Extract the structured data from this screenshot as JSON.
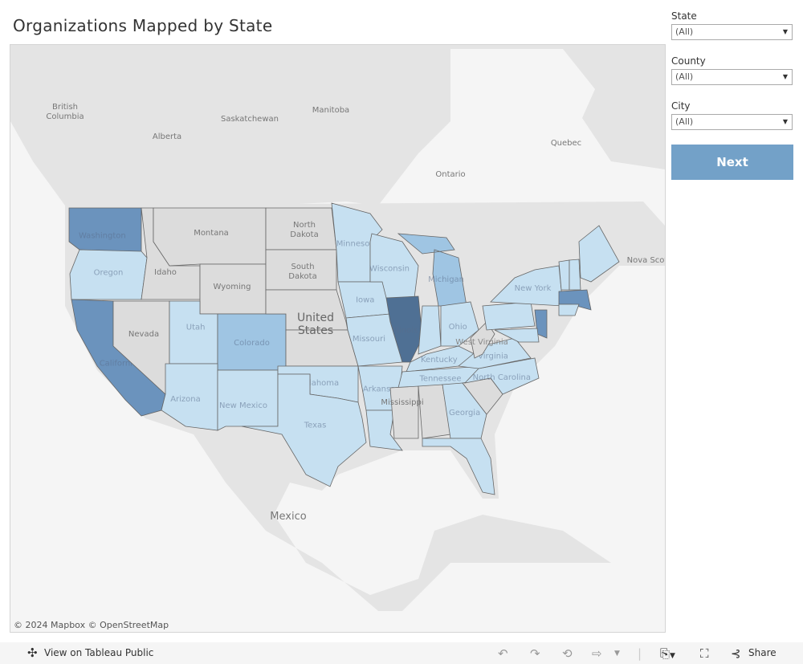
{
  "title": "Organizations Mapped by State",
  "filters": [
    {
      "label": "State",
      "value": "(All)"
    },
    {
      "label": "County",
      "value": "(All)"
    },
    {
      "label": "City",
      "value": "(All)"
    }
  ],
  "next_button": "Next",
  "map": {
    "attribution": "© 2024 Mapbox  © OpenStreetMap",
    "colors": {
      "none": "#dcdcdc",
      "light": "#c6e0f1",
      "medium": "#9fc5e3",
      "dark": "#6b93bd",
      "darkest": "#4f7094",
      "land": "#e4e4e4",
      "water": "#f5f5f5"
    },
    "base_labels": [
      "British Columbia",
      "Alberta",
      "Saskatchewan",
      "Manitoba",
      "Ontario",
      "Quebec",
      "Nova Scot",
      "Montana",
      "Idaho",
      "Wyoming",
      "North Dakota",
      "South Dakota",
      "Nevada",
      "United States",
      "Mexico",
      "Mississippi"
    ],
    "states": [
      {
        "name": "Washington",
        "level": "dark",
        "label": "Washington"
      },
      {
        "name": "Oregon",
        "level": "light",
        "label": "Oregon"
      },
      {
        "name": "California",
        "level": "dark",
        "label": "California"
      },
      {
        "name": "Nevada",
        "level": "none"
      },
      {
        "name": "Idaho",
        "level": "none"
      },
      {
        "name": "Montana",
        "level": "none"
      },
      {
        "name": "Wyoming",
        "level": "none"
      },
      {
        "name": "Utah",
        "level": "light",
        "label": "Utah"
      },
      {
        "name": "Colorado",
        "level": "medium",
        "label": "Colorado"
      },
      {
        "name": "Arizona",
        "level": "light",
        "label": "Arizona"
      },
      {
        "name": "New Mexico",
        "level": "light",
        "label": "New Mexico"
      },
      {
        "name": "North Dakota",
        "level": "none"
      },
      {
        "name": "South Dakota",
        "level": "none"
      },
      {
        "name": "Nebraska",
        "level": "none"
      },
      {
        "name": "Kansas",
        "level": "none"
      },
      {
        "name": "Oklahoma",
        "level": "light",
        "label": "Oklahoma"
      },
      {
        "name": "Texas",
        "level": "light",
        "label": "Texas"
      },
      {
        "name": "Minnesota",
        "level": "light",
        "label": "Minnesota"
      },
      {
        "name": "Iowa",
        "level": "light",
        "label": "Iowa"
      },
      {
        "name": "Missouri",
        "level": "light",
        "label": "Missouri"
      },
      {
        "name": "Arkansas",
        "level": "light",
        "label": "Arkansas"
      },
      {
        "name": "Louisiana",
        "level": "light"
      },
      {
        "name": "Wisconsin",
        "level": "light",
        "label": "Wisconsin"
      },
      {
        "name": "Illinois",
        "level": "darkest",
        "label": "Illinois"
      },
      {
        "name": "Michigan",
        "level": "medium",
        "label": "Michigan"
      },
      {
        "name": "Indiana",
        "level": "light"
      },
      {
        "name": "Ohio",
        "level": "light",
        "label": "Ohio"
      },
      {
        "name": "Kentucky",
        "level": "light",
        "label": "Kentucky"
      },
      {
        "name": "Tennessee",
        "level": "light",
        "label": "Tennessee"
      },
      {
        "name": "Mississippi",
        "level": "none"
      },
      {
        "name": "Alabama",
        "level": "none"
      },
      {
        "name": "Georgia",
        "level": "light",
        "label": "Georgia"
      },
      {
        "name": "Florida",
        "level": "light"
      },
      {
        "name": "South Carolina",
        "level": "none"
      },
      {
        "name": "North Carolina",
        "level": "light",
        "label": "North Carolina"
      },
      {
        "name": "Virginia",
        "level": "light",
        "label": "Virginia"
      },
      {
        "name": "West Virginia",
        "level": "none",
        "label": "West Virginia"
      },
      {
        "name": "Pennsylvania",
        "level": "light"
      },
      {
        "name": "New York",
        "level": "light",
        "label": "New York"
      },
      {
        "name": "New Jersey",
        "level": "dark"
      },
      {
        "name": "Maryland",
        "level": "light"
      },
      {
        "name": "Vermont",
        "level": "light"
      },
      {
        "name": "New Hampshire",
        "level": "light"
      },
      {
        "name": "Maine",
        "level": "light"
      },
      {
        "name": "Massachusetts",
        "level": "dark"
      },
      {
        "name": "Connecticut",
        "level": "light"
      }
    ]
  },
  "toolbar": {
    "view_on_public": "View on Tableau Public",
    "share": "Share",
    "icons": [
      "undo-icon",
      "redo-icon",
      "revert-icon",
      "refresh-icon",
      "download-icon",
      "fullscreen-icon",
      "share-icon"
    ]
  }
}
